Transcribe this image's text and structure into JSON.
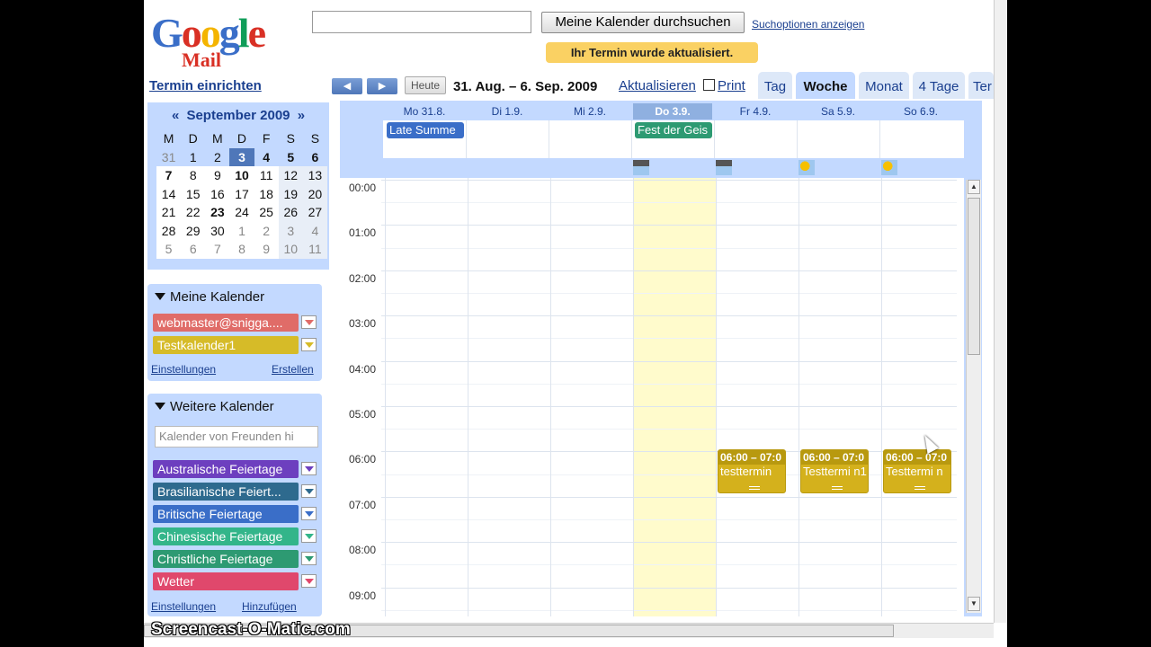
{
  "header": {
    "logo_google": "Google",
    "logo_mail": "Mail",
    "search_placeholder": "",
    "search_button": "Meine Kalender durchsuchen",
    "search_options": "Suchoptionen anzeigen",
    "notice": "Ihr Termin wurde aktualisiert.",
    "create_event": "Termin einrichten"
  },
  "nav": {
    "prev": "◀",
    "next": "▶",
    "today": "Heute",
    "date_range": "31. Aug. – 6. Sep. 2009",
    "refresh": "Aktualisieren",
    "print": "Print",
    "tabs": [
      "Tag",
      "Woche",
      "Monat",
      "4 Tage",
      "Ter"
    ],
    "active_tab": "Woche"
  },
  "minical": {
    "prev": "«",
    "next": "»",
    "title": "September 2009",
    "weekdays": [
      "M",
      "D",
      "M",
      "D",
      "F",
      "S",
      "S"
    ],
    "weeks": [
      [
        "31",
        "1",
        "2",
        "3",
        "4",
        "5",
        "6"
      ],
      [
        "7",
        "8",
        "9",
        "10",
        "11",
        "12",
        "13"
      ],
      [
        "14",
        "15",
        "16",
        "17",
        "18",
        "19",
        "20"
      ],
      [
        "21",
        "22",
        "23",
        "24",
        "25",
        "26",
        "27"
      ],
      [
        "28",
        "29",
        "30",
        "1",
        "2",
        "3",
        "4"
      ],
      [
        "5",
        "6",
        "7",
        "8",
        "9",
        "10",
        "11"
      ]
    ]
  },
  "my_calendars": {
    "title": "Meine Kalender",
    "items": [
      {
        "label": "webmaster@snigga....",
        "color": "#e06c68"
      },
      {
        "label": "Testkalender1",
        "color": "#d6bb28"
      }
    ],
    "settings": "Einstellungen",
    "create": "Erstellen"
  },
  "other_calendars": {
    "title": "Weitere Kalender",
    "friend_placeholder": "Kalender von Freunden hi",
    "items": [
      {
        "label": "Australische Feiertage",
        "color": "#6d3fbf"
      },
      {
        "label": "Brasilianische Feiert...",
        "color": "#2e6a8e"
      },
      {
        "label": "Britische Feiertage",
        "color": "#3a6ec8"
      },
      {
        "label": "Chinesische Feiertage",
        "color": "#33b58a"
      },
      {
        "label": "Christliche Feiertage",
        "color": "#2d9a72"
      },
      {
        "label": "Wetter",
        "color": "#e0486c"
      }
    ],
    "settings": "Einstellungen",
    "add": "Hinzufügen"
  },
  "week": {
    "days": [
      "Mo 31.8.",
      "Di 1.9.",
      "Mi 2.9.",
      "Do 3.9.",
      "Fr 4.9.",
      "Sa 5.9.",
      "So 6.9."
    ],
    "today_index": 3,
    "allday_events": [
      {
        "label": "Late Summe",
        "color": "#3a6ec8"
      },
      {
        "label": "Fest der Geis",
        "color": "#2d9a72"
      }
    ],
    "hours": [
      "00:00",
      "01:00",
      "02:00",
      "03:00",
      "04:00",
      "05:00",
      "06:00",
      "07:00",
      "08:00",
      "09:00"
    ],
    "events": [
      {
        "time": "06:00 – 07:0",
        "name": "testtermin"
      },
      {
        "time": "06:00 – 07:0",
        "name": "Testtermi n1"
      },
      {
        "time": "06:00 – 07:0",
        "name": "Testtermi n"
      }
    ]
  },
  "watermark": "Screencast-O-Matic.com"
}
